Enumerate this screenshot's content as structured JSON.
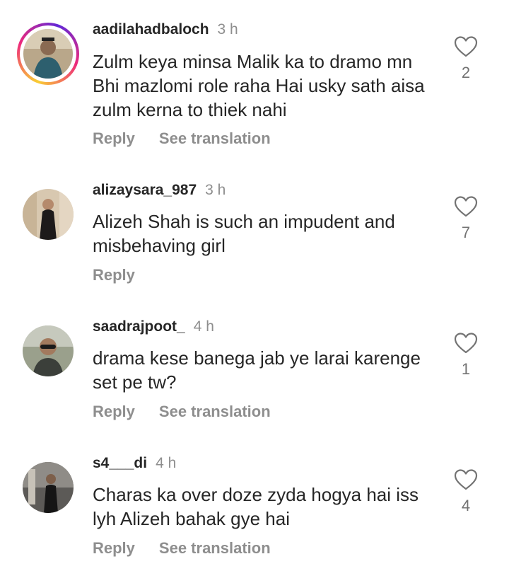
{
  "comments": [
    {
      "username": "aadilahadbaloch",
      "time": "3 h",
      "text": "Zulm keya minsa Malik ka to dramo mn Bhi mazlomi role raha Hai usky sath aisa zulm kerna to thiek nahi",
      "reply": "Reply",
      "translation": "See translation",
      "likes": "2",
      "story_ring": true
    },
    {
      "username": "alizaysara_987",
      "time": "3 h",
      "text": "Alizeh Shah is such an impudent and misbehaving girl",
      "reply": "Reply",
      "translation": "",
      "likes": "7",
      "story_ring": false
    },
    {
      "username": "saadrajpoot_",
      "time": "4 h",
      "text": "drama kese banega jab ye larai karenge set pe tw?",
      "reply": "Reply",
      "translation": "See translation",
      "likes": "1",
      "story_ring": false
    },
    {
      "username": "s4___di",
      "time": "4 h",
      "text": "Charas ka over doze zyda hogya hai iss lyh Alizeh bahak gye hai",
      "reply": "Reply",
      "translation": "See translation",
      "likes": "4",
      "story_ring": false
    }
  ],
  "colors": {
    "text": "#262626",
    "muted": "#8e8e8e",
    "heart_stroke": "#737373"
  },
  "icons": {
    "like": "heart-outline-icon",
    "avatar": "user-avatar"
  }
}
